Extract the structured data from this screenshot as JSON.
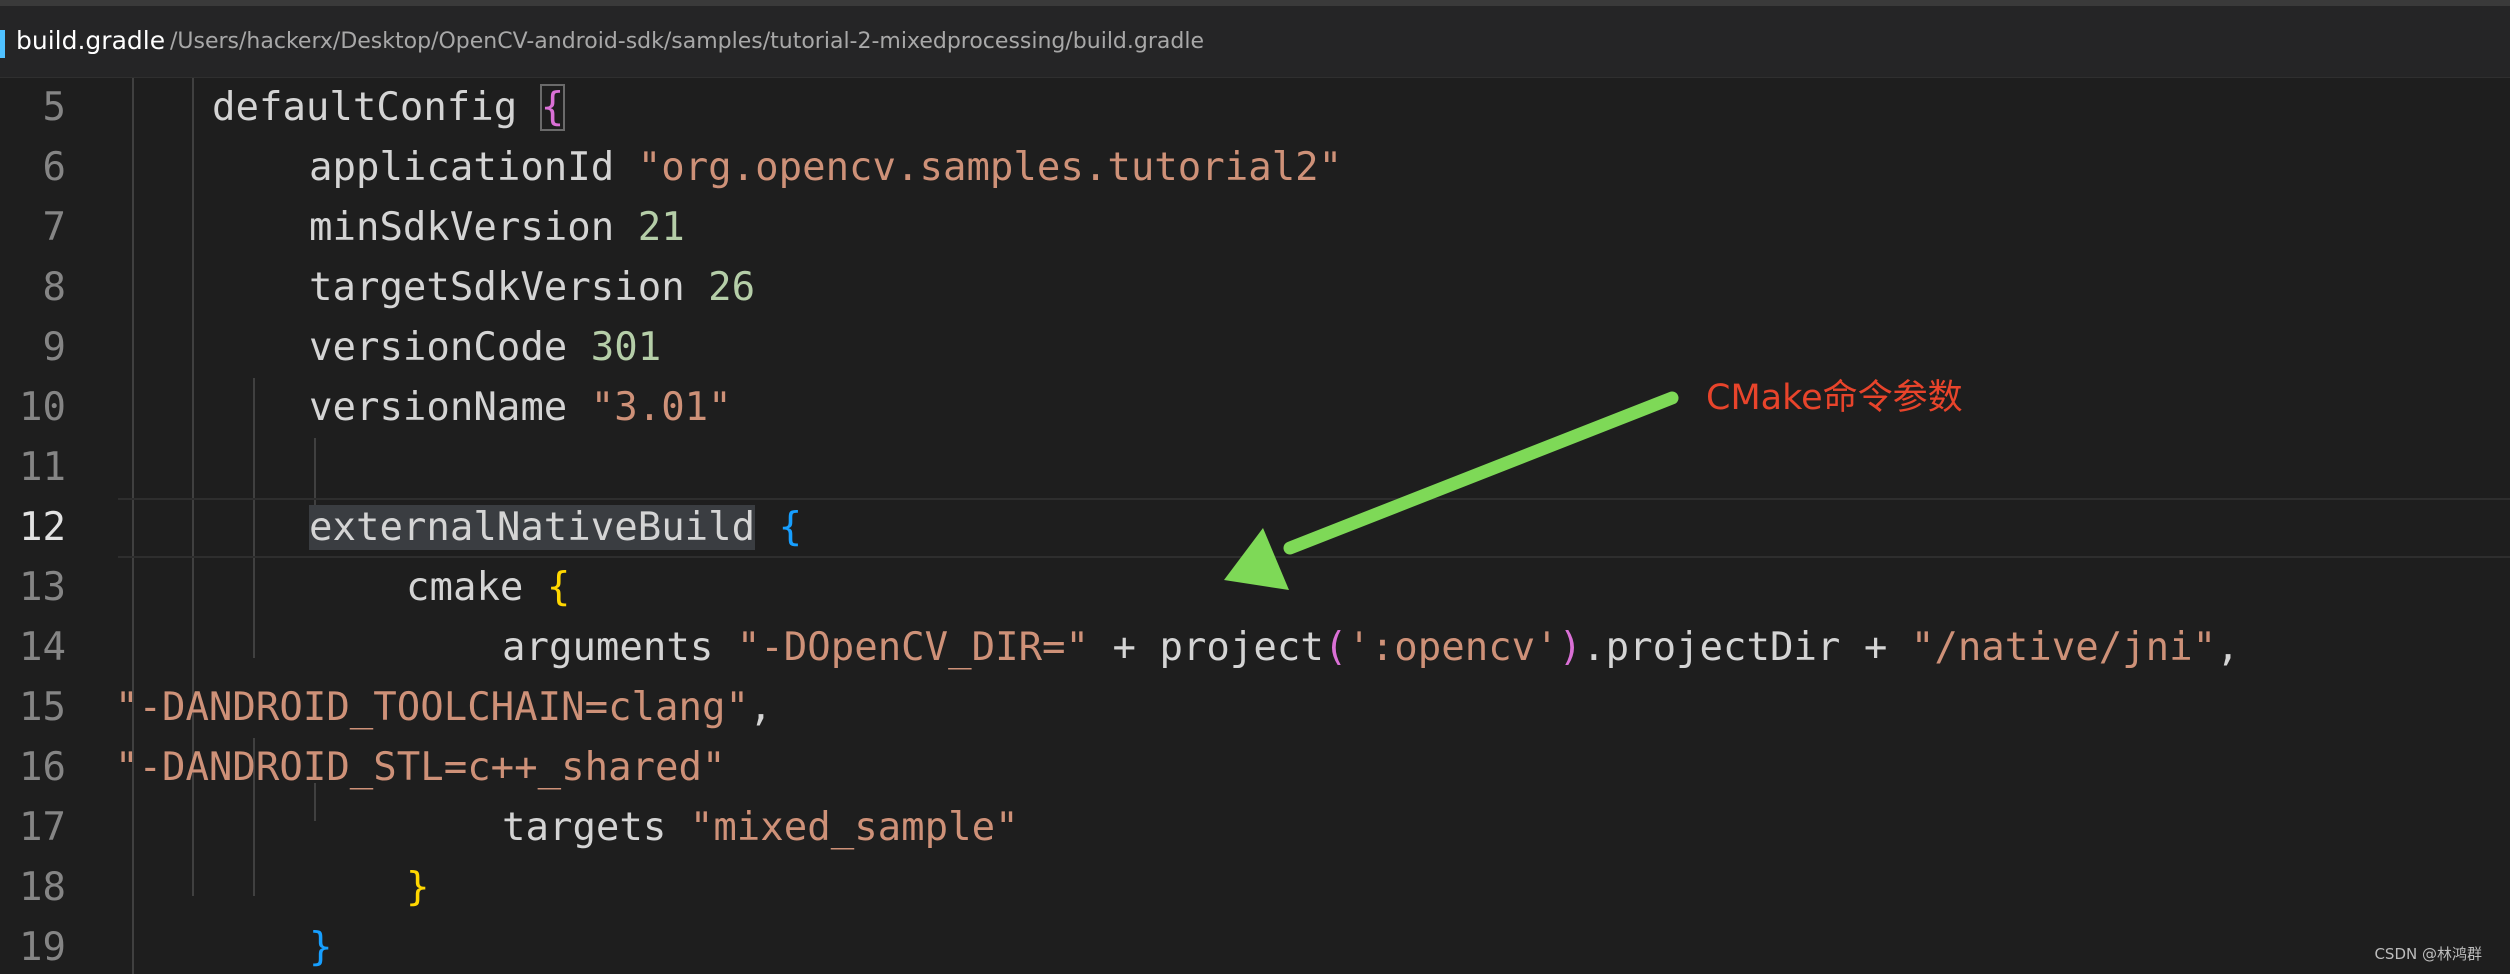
{
  "tab": {
    "file_name": "build.gradle",
    "file_path": "/Users/hackerx/Desktop/OpenCV-android-sdk/samples/tutorial-2-mixedprocessing/build.gradle"
  },
  "lines": [
    {
      "n": "5",
      "t": {
        "a": "defaultConfig ",
        "b": "{"
      }
    },
    {
      "n": "6",
      "t": {
        "a": "applicationId ",
        "b": "\"org.opencv.samples.tutorial2\""
      }
    },
    {
      "n": "7",
      "t": {
        "a": "minSdkVersion ",
        "b": "21"
      }
    },
    {
      "n": "8",
      "t": {
        "a": "targetSdkVersion ",
        "b": "26"
      }
    },
    {
      "n": "9",
      "t": {
        "a": "versionCode ",
        "b": "301"
      }
    },
    {
      "n": "10",
      "t": {
        "a": "versionName ",
        "b": "\"3.01\""
      }
    },
    {
      "n": "11",
      "t": {}
    },
    {
      "n": "12",
      "t": {
        "a": "externalNativeBuild",
        "b": " ",
        "c": "{"
      }
    },
    {
      "n": "13",
      "t": {
        "a": "cmake ",
        "b": "{"
      }
    },
    {
      "n": "14",
      "t": {
        "a": "arguments ",
        "b": "\"-DOpenCV_DIR=\"",
        "c": " + project",
        "d": "(",
        "e": "':opencv'",
        "f": ")",
        "g": ".projectDir + ",
        "h": "\"/native/jni\"",
        "i": ","
      }
    },
    {
      "n": "15",
      "t": {
        "a": "\"-DANDROID_TOOLCHAIN=clang\"",
        "b": ","
      }
    },
    {
      "n": "16",
      "t": {
        "a": "\"-DANDROID_STL=c++_shared\""
      }
    },
    {
      "n": "17",
      "t": {
        "a": "targets ",
        "b": "\"mixed_sample\""
      }
    },
    {
      "n": "18",
      "t": {
        "a": "}"
      }
    },
    {
      "n": "19",
      "t": {
        "a": "}"
      }
    }
  ],
  "annotation": {
    "text": "CMake命令参数",
    "color": "#e8442b",
    "arrow_color": "#7ed957"
  },
  "watermark": "CSDN @林鸿群",
  "colors": {
    "background": "#1e1e1e",
    "string": "#ce9178",
    "number": "#b5cea8",
    "bracket_level1": "#ffd700",
    "bracket_level2": "#da70d6",
    "bracket_level3": "#179fff"
  }
}
